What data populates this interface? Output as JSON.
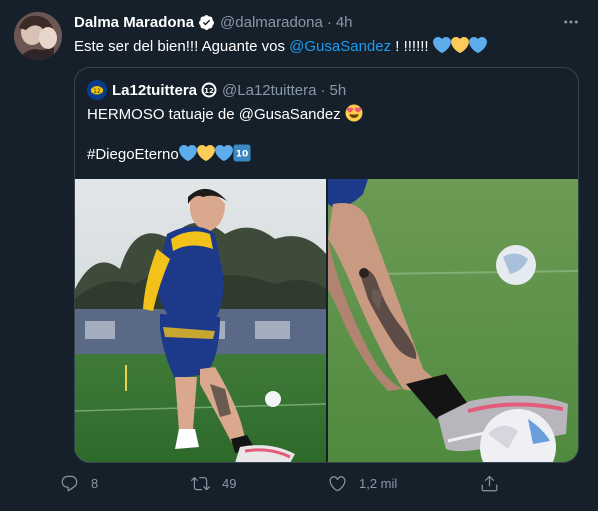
{
  "tweet": {
    "author_name": "Dalma Maradona",
    "author_handle": "@dalmaradona",
    "separator": "·",
    "time": "4h",
    "text_prefix": "Este ser del bien!!! Aguante vos ",
    "text_mention": "@GusaSandez",
    "text_suffix": " ! !!!!!!",
    "text_emojis": [
      "blue-heart",
      "yellow-heart",
      "blue-heart"
    ]
  },
  "quote": {
    "author_name": "La12tuittera",
    "author_handle": "@La12tuittera",
    "separator": "·",
    "time": "5h",
    "line1_prefix": "HERMOSO tatuaje de @GusaSandez ",
    "line2_hashtag": "#DiegoEterno",
    "line2_emojis": [
      "blue-heart",
      "yellow-heart",
      "blue-heart",
      "keycap-10"
    ],
    "images": [
      "player-kicking-ball-photo",
      "calf-tattoo-closeup-photo"
    ]
  },
  "actions": {
    "reply_count": "8",
    "retweet_count": "49",
    "like_count": "1,2 mil"
  },
  "colors": {
    "background": "#15202b",
    "text": "#ffffff",
    "muted": "#8899a6",
    "accent": "#1d9bf0",
    "border": "#38444d"
  }
}
